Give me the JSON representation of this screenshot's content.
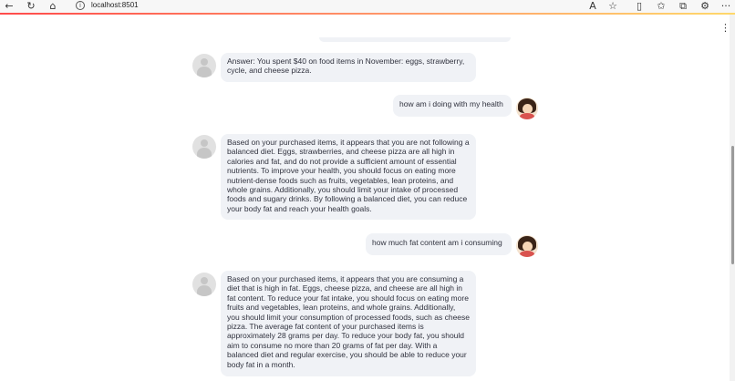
{
  "browser": {
    "url": "localhost:8501",
    "icons": {
      "back": "back-arrow-icon",
      "reload": "reload-icon",
      "home": "home-icon",
      "info": "info-icon",
      "read_aloud": "read-aloud-icon",
      "favorite": "star-icon",
      "split_screen": "split-screen-icon",
      "favorites": "favorites-icon",
      "collections": "collections-icon",
      "extensions": "extensions-icon",
      "more": "more-icon"
    },
    "glyphs": {
      "back": "←",
      "reload": "↻",
      "home": "⌂",
      "info": "i",
      "read_aloud": "A",
      "favorite": "☆",
      "split_screen": "▯",
      "favorites": "✩",
      "collections": "⧉",
      "extensions": "⚙",
      "more": "···",
      "menu": "⋮"
    }
  },
  "theme": {
    "bubble_bg": "#f0f2f6",
    "text_color": "#31333f",
    "accent_gradient": [
      "#ff4b4b",
      "#ffd86b"
    ]
  },
  "chat": {
    "messages": [
      {
        "role": "assistant",
        "text": "Answer: You spent $40 on food items in November: eggs, strawberry, cycle, and cheese pizza."
      },
      {
        "role": "user",
        "text": "how am i doing with my health"
      },
      {
        "role": "assistant",
        "text": "Based on your purchased items, it appears that you are not following a balanced diet. Eggs, strawberries, and cheese pizza are all high in calories and fat, and do not provide a sufficient amount of essential nutrients. To improve your health, you should focus on eating more nutrient-dense foods such as fruits, vegetables, lean proteins, and whole grains. Additionally, you should limit your intake of processed foods and sugary drinks. By following a balanced diet, you can reduce your body fat and reach your health goals."
      },
      {
        "role": "user",
        "text": "how much fat content am i consuming"
      },
      {
        "role": "assistant",
        "text": "Based on your purchased items, it appears that you are consuming a diet that is high in fat. Eggs, cheese pizza, and cheese are all high in fat content. To reduce your fat intake, you should focus on eating more fruits and vegetables, lean proteins, and whole grains. Additionally, you should limit your consumption of processed foods, such as cheese pizza. The average fat content of your purchased items is approximately 28 grams per day. To reduce your body fat, you should aim to consume no more than 20 grams of fat per day. With a balanced diet and regular exercise, you should be able to reduce your body fat in a month."
      }
    ]
  }
}
